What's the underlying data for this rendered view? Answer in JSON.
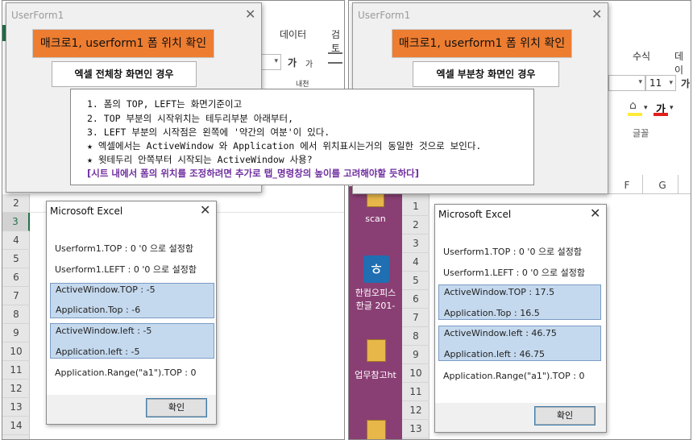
{
  "left": {
    "userform": {
      "title": "UserForm1",
      "macro_button": "매크로1, userform1 폼 위치 확인",
      "mode_button": "엑셀 전체창 화면인 경우"
    },
    "ribbon": {
      "tab_data": "데이터",
      "tab_review": "검토",
      "font_a1": "가",
      "font_a2": "가",
      "wrap": "내천"
    },
    "rows": [
      "2",
      "3",
      "4",
      "5",
      "6",
      "7",
      "8",
      "9",
      "10",
      "11",
      "12",
      "13",
      "14"
    ],
    "msgbox": {
      "title": "Microsoft Excel",
      "lines": [
        "Userform1.TOP : 0 '0 으로 설정함",
        "Userform1.LEFT : 0 '0 으로 설정함"
      ],
      "hl1": [
        "ActiveWindow.TOP : -5",
        "Application.Top : -6"
      ],
      "hl2": [
        "ActiveWindow.left : -5",
        "Application.left : -5"
      ],
      "range_line": "Application.Range(\"a1\").TOP : 0",
      "ok": "확인"
    }
  },
  "note": {
    "lines": [
      "1. 폼의 TOP, LEFT는 화면기준이고",
      "2. TOP 부분의 시작위치는 테두리부분 아래부터,",
      "3. LEFT 부분의 시작점은 왼쪽에 '약간의 여분'이 있다.",
      "★ 엑셀에서는 ActiveWindow 와 Application 에서 위치표시는거의 동일한 것으로 보인다.",
      "★ 윗테두리 안쪽부터 시작되는 ActiveWindow 사용?"
    ],
    "emphasis": "[시트 내에서 폼의 위치를 조정하려면 추가로 탭_명령창의 높이를 고려해야할 듯하다]"
  },
  "right": {
    "userform": {
      "title": "UserForm1",
      "macro_button": "매크로1, userform1 폼 위치 확인",
      "mode_button": "엑셀 부분창 화면인 경우"
    },
    "ribbon": {
      "tab_formula": "수식",
      "tab_data": "데이",
      "font_size": "11",
      "font_a": "가",
      "font_a2": "가",
      "font_group": "글꼴"
    },
    "columns": [
      "F",
      "G"
    ],
    "rows": [
      "1",
      "2",
      "3",
      "4",
      "5",
      "6",
      "7",
      "8",
      "9",
      "10",
      "11",
      "12",
      "13"
    ],
    "desktop": {
      "scan": "scan",
      "hancom": "한컴오피스",
      "hangul": "한글 201-",
      "work": "업무참고ht"
    },
    "msgbox": {
      "title": "Microsoft Excel",
      "lines": [
        "Userform1.TOP : 0 '0 으로 설정함",
        "Userform1.LEFT : 0 '0 으로 설정함"
      ],
      "hl1": [
        "ActiveWindow.TOP : 17.5",
        "Application.Top : 16.5"
      ],
      "hl2": [
        "ActiveWindow.left : 46.75",
        "Application.left : 46.75"
      ],
      "range_line": "Application.Range(\"a1\").TOP : 0",
      "ok": "확인"
    }
  },
  "colors": {
    "accent_orange": "#ed7d31",
    "highlight": "#c5d9ee",
    "excel_green": "#217346",
    "purple_text": "#7030a0",
    "desktop_bg": "#8a3f74"
  }
}
